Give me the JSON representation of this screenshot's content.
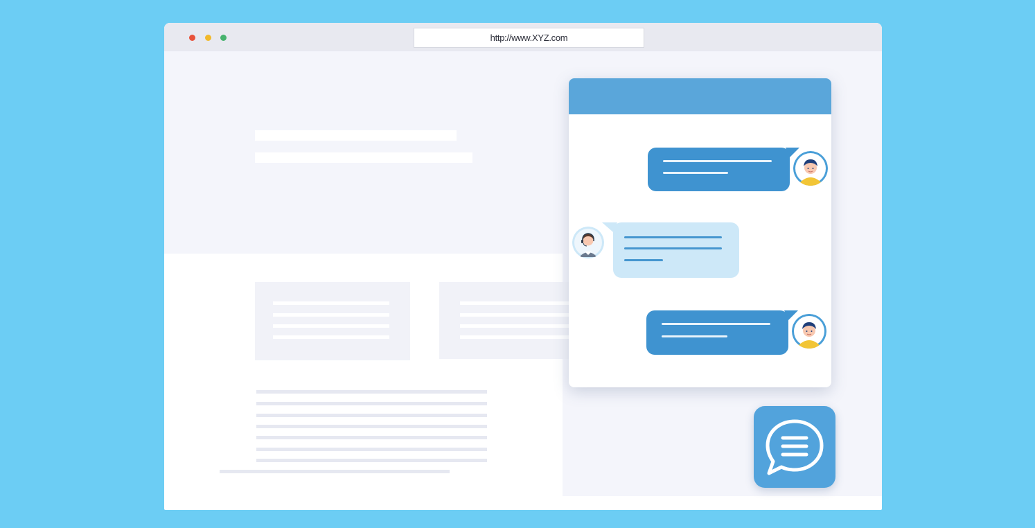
{
  "browser": {
    "url": "http://www.XYZ.com",
    "window_controls": [
      "close-dot",
      "minimize-dot",
      "maximize-dot"
    ]
  },
  "chat": {
    "messages": [
      {
        "direction": "outgoing",
        "avatar": "male-user-avatar-icon"
      },
      {
        "direction": "incoming",
        "avatar": "support-agent-headset-avatar-icon"
      },
      {
        "direction": "outgoing",
        "avatar": "male-user-avatar-icon"
      }
    ]
  },
  "launcher": {
    "icon": "chat-bubble-icon"
  },
  "colors": {
    "background": "#6ccdf4",
    "chat_header": "#5aa6da",
    "outgoing_bubble": "#3f93d0",
    "incoming_bubble": "#cde8f8",
    "launcher": "#52a3dc"
  }
}
